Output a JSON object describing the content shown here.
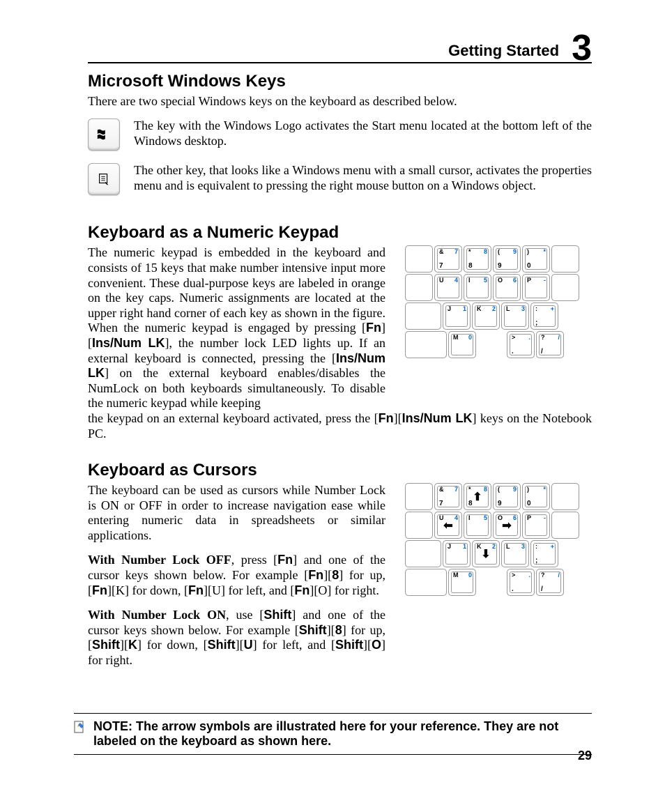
{
  "header": {
    "section": "Getting Started",
    "chapter": "3"
  },
  "s1": {
    "title": "Microsoft Windows Keys",
    "intro": "There are two special Windows keys on the keyboard as described below.",
    "logo_desc": "The key with the Windows Logo activates the Start menu located at the bottom left of the Windows desktop.",
    "menu_desc": "The other key, that looks like a Windows menu with a small cursor, activates the properties menu and is equivalent to pressing the right mouse button on a Windows object."
  },
  "s2": {
    "title": "Keyboard as a Numeric Keypad",
    "p1a": "The numeric keypad is embedded in the keyboard and consists of 15 keys that make number intensive input more convenient. These dual-purpose keys are labeled in orange on the key caps. Numeric assignments are located at the upper right hand corner of each key as shown in the figure. When the numeric keypad is engaged by pressing [",
    "fn": "Fn",
    "p1b": "][",
    "ins": "Ins/Num LK",
    "p1c": "], the number lock LED lights up. If an external keyboard is connected, pressing the [",
    "p1d": "] on the external keyboard enables/disables the NumLock on both keyboards simultaneously. To disable the numeric keypad while keeping",
    "p2a": "the keypad on an external keyboard activated, press the  [",
    "p2b": "][",
    "p2c": "] keys on the Notebook PC."
  },
  "s3": {
    "title": "Keyboard as Cursors",
    "p1": "The keyboard can be used as cursors while Number Lock is ON or OFF in order to increase navigation ease while entering numeric data in spreadsheets or similar applications.",
    "p2_lead": "With Number Lock OFF",
    "p2a": ", press [",
    "p2b": "] and one of the cursor keys shown below. For example [",
    "p2c": "][",
    "p2d": "] for up, [",
    "p2e": "][K] for down, [",
    "p2f": "][U] for left, and [",
    "p2g": "][O] for right.",
    "k8": "8",
    "p3_lead": "With Number Lock ON",
    "p3a": ", use [",
    "shift": "Shift",
    "p3b": "] and one of the cursor keys shown below. For example [",
    "p3c": "][",
    "p3d": "] for up, [",
    "kK": "K",
    "p3e": "] for down, [",
    "kU": "U",
    "p3f": "] for left, and [",
    "kO": "O",
    "p3g": "] for right."
  },
  "keypad": {
    "r1": [
      {
        "tl": "&",
        "tr": "7",
        "bl": "7"
      },
      {
        "tl": "*",
        "tr": "8",
        "bl": "8"
      },
      {
        "tl": "(",
        "tr": "9",
        "bl": "9"
      },
      {
        "tl": ")",
        "tr": "*",
        "bl": "0"
      }
    ],
    "r2": [
      {
        "tl": "U",
        "tr": "4",
        "bl": ""
      },
      {
        "tl": "I",
        "tr": "5",
        "bl": ""
      },
      {
        "tl": "O",
        "tr": "6",
        "bl": ""
      },
      {
        "tl": "P",
        "tr": "-",
        "bl": ""
      }
    ],
    "r3": [
      {
        "tl": "J",
        "tr": "1",
        "bl": ""
      },
      {
        "tl": "K",
        "tr": "2",
        "bl": ""
      },
      {
        "tl": "L",
        "tr": "3",
        "bl": ""
      },
      {
        "tl": ":",
        "tr": "+",
        "bl": ";"
      }
    ],
    "r4": [
      {
        "tl": "M",
        "tr": "0",
        "bl": ""
      },
      {
        "tl": ">",
        "tr": ".",
        "bl": "."
      },
      {
        "tl": "?",
        "tr": "/",
        "bl": "/"
      }
    ]
  },
  "cursor_arrows": {
    "up_idx": 1,
    "left_idx": 0,
    "right_idx": 2,
    "down_idx": 1
  },
  "note": "NOTE: The arrow symbols are illustrated here for your reference. They are not labeled on the keyboard as shown here.",
  "page": "29"
}
